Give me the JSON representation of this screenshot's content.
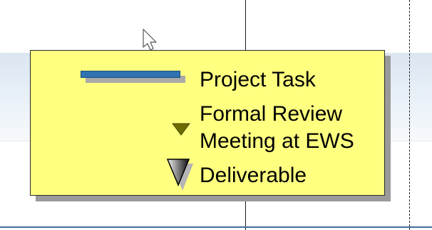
{
  "legend": {
    "items": [
      {
        "label": "Project Task",
        "symbol": "bar",
        "color": "#2e72b2"
      },
      {
        "label_line1": "Formal Review",
        "label_line2": "Meeting at EWS",
        "symbol": "small-triangle",
        "color": "#6b6b00"
      },
      {
        "label": "Deliverable",
        "symbol": "large-triangle",
        "color": "#1a1a1a"
      }
    ],
    "background_color": "#ffff80"
  },
  "colors": {
    "band": "#dbe6f1",
    "bottom_line": "#3f6f9a"
  }
}
